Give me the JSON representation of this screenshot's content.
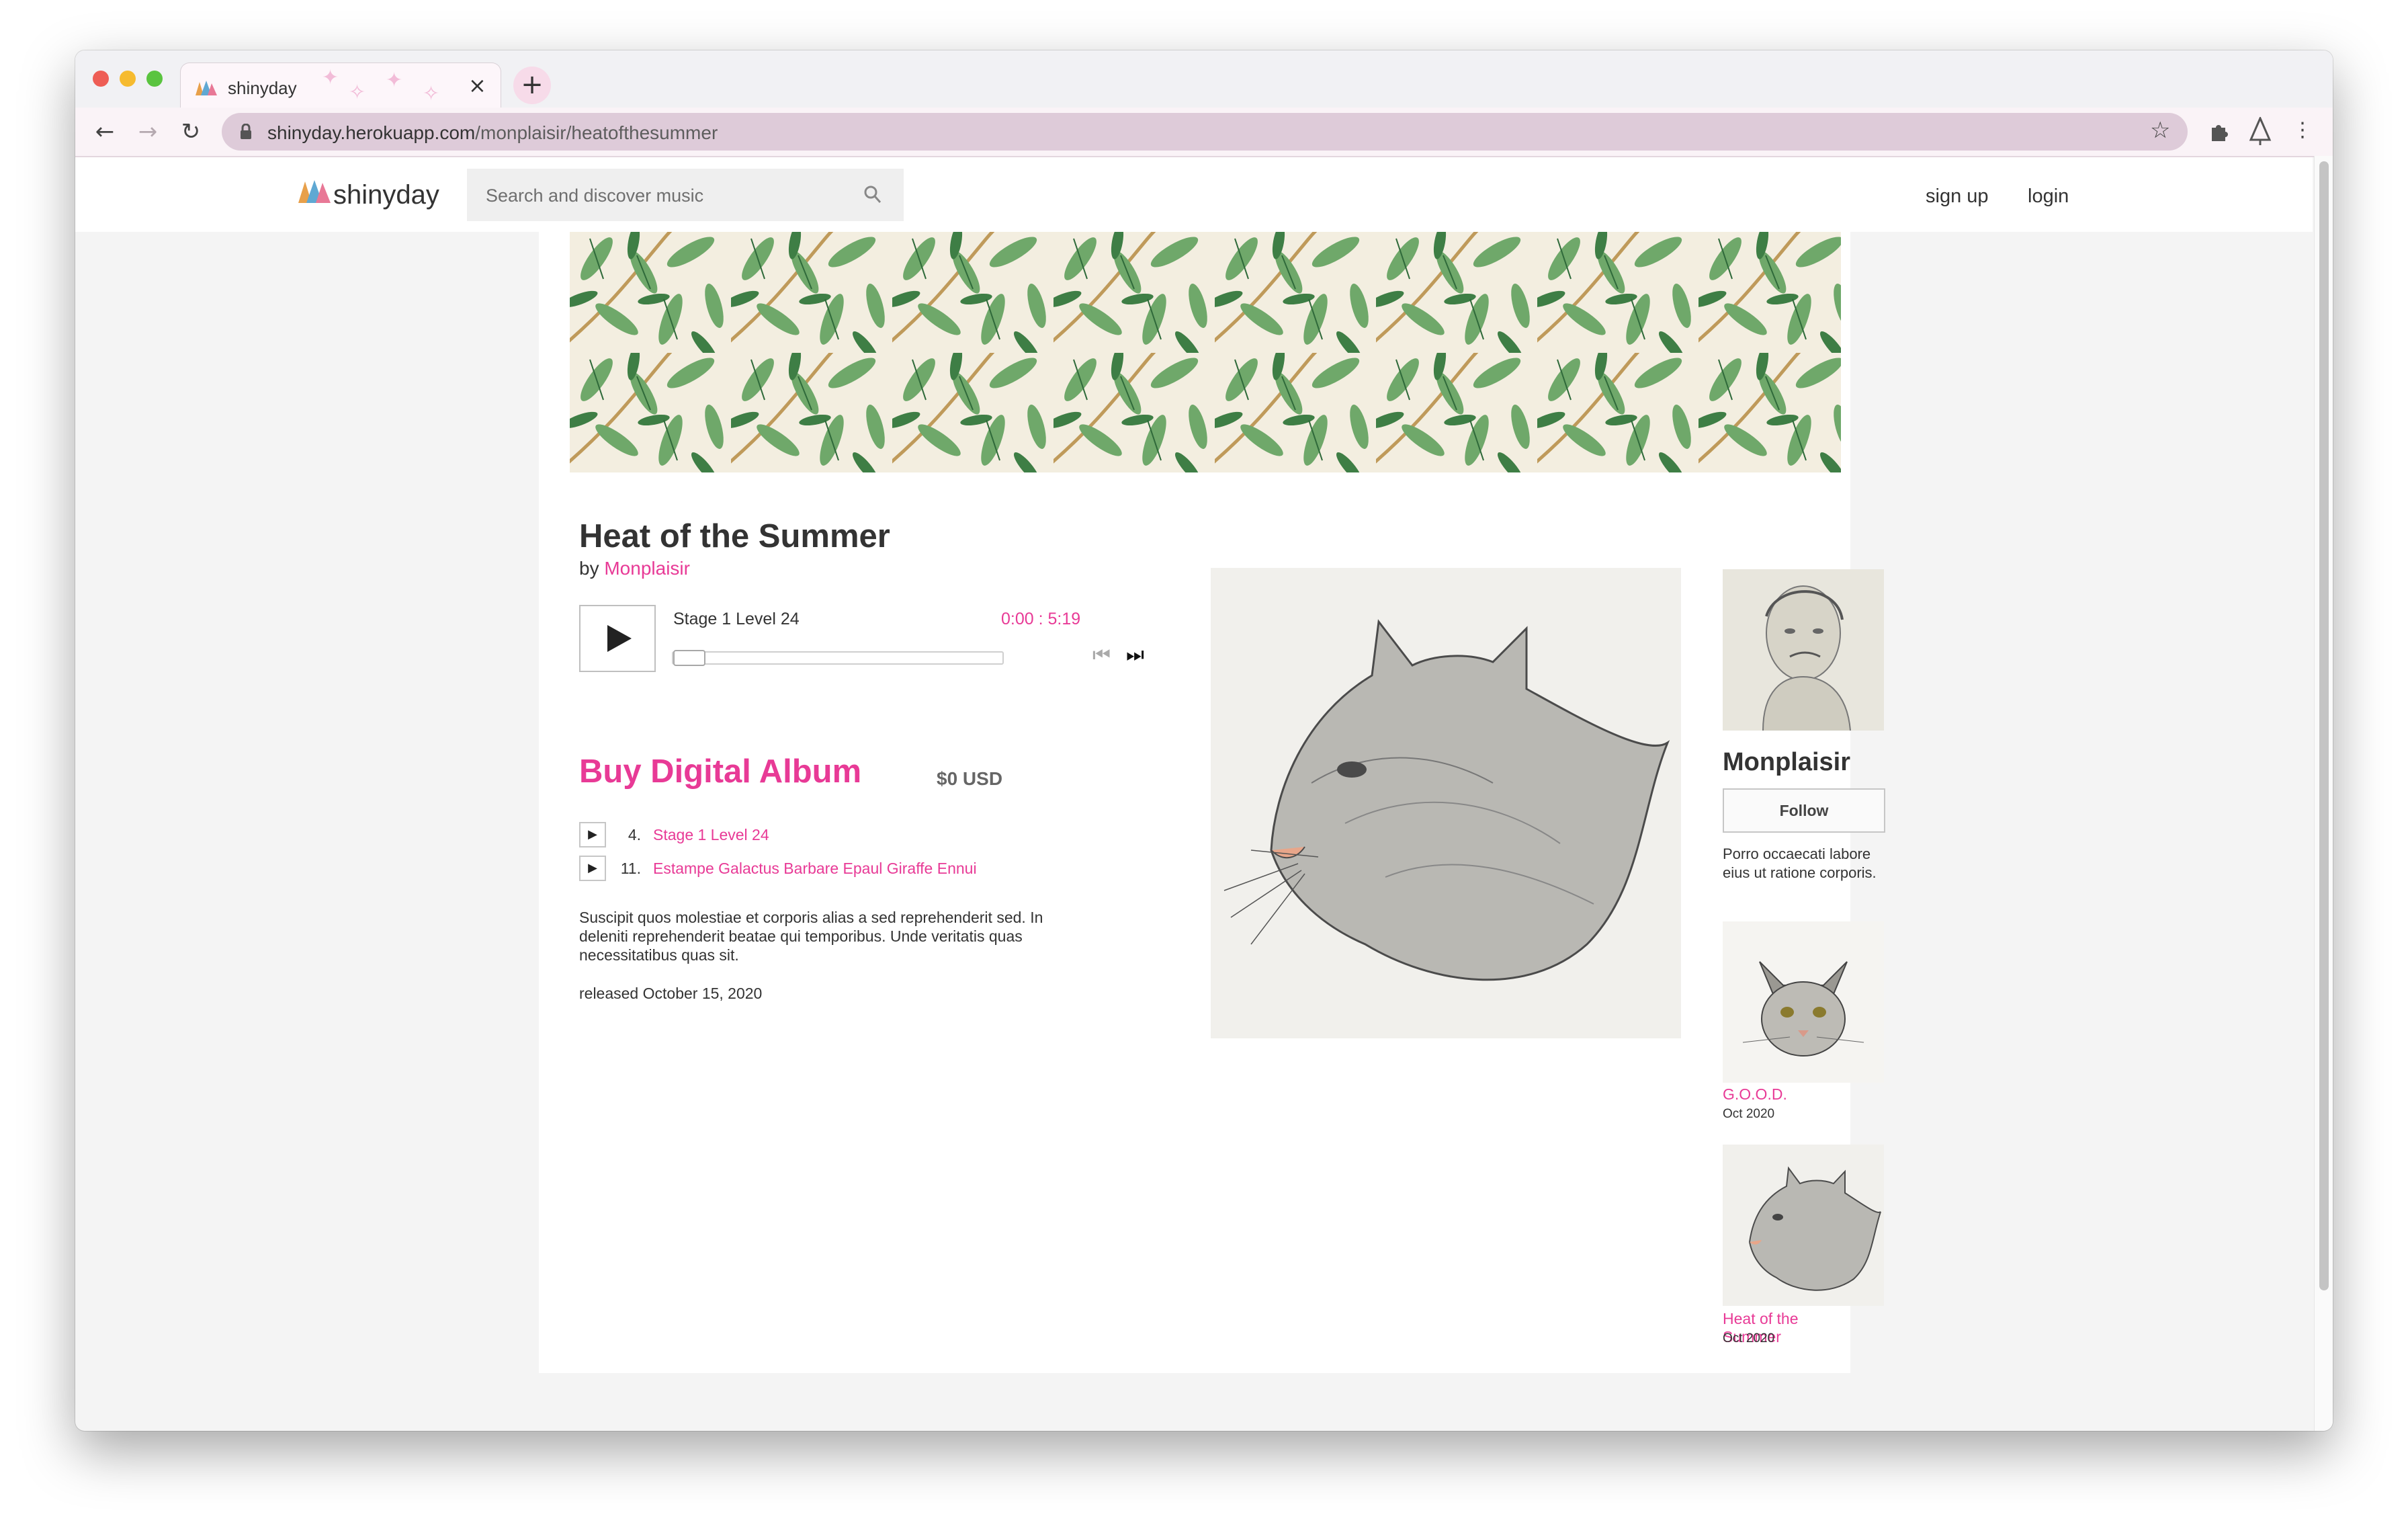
{
  "browser": {
    "tab_title": "shinyday",
    "url_domain": "shinyday.herokuapp.com",
    "url_path": "/monplaisir/heatofthesummer"
  },
  "header": {
    "logo_text": "shinyday",
    "search_placeholder": "Search and discover music",
    "signup_label": "sign up",
    "login_label": "login"
  },
  "album": {
    "title": "Heat of the Summer",
    "by_prefix": "by",
    "artist": "Monplaisir",
    "player": {
      "current_track": "Stage 1 Level 24",
      "elapsed": "0:00",
      "time_separator": " : ",
      "duration": "5:19",
      "progress": 0
    },
    "buy_label": "Buy Digital Album",
    "price": "$0 USD",
    "tracks": [
      {
        "number": "4.",
        "title": "Stage 1 Level 24"
      },
      {
        "number": "11.",
        "title": "Estampe Galactus Barbare Epaul Giraffe Ennui"
      }
    ],
    "description": "Suscipit quos molestiae et corporis alias a sed reprehenderit sed. In deleniti reprehenderit beatae qui temporibus. Unde veritatis quas necessitatibus quas sit.",
    "released": "released October 15, 2020"
  },
  "artist_panel": {
    "name": "Monplaisir",
    "follow_label": "Follow",
    "bio": "Porro occaecati labore eius ut ratione corporis.",
    "discography": [
      {
        "title": "G.O.O.D.",
        "date": "Oct 2020"
      },
      {
        "title": "Heat of the Summer",
        "date": "Oct 2020"
      }
    ]
  },
  "colors": {
    "accent": "#e83a96",
    "omnibox": "#decbd9",
    "page_bg": "#f4f4f4"
  }
}
